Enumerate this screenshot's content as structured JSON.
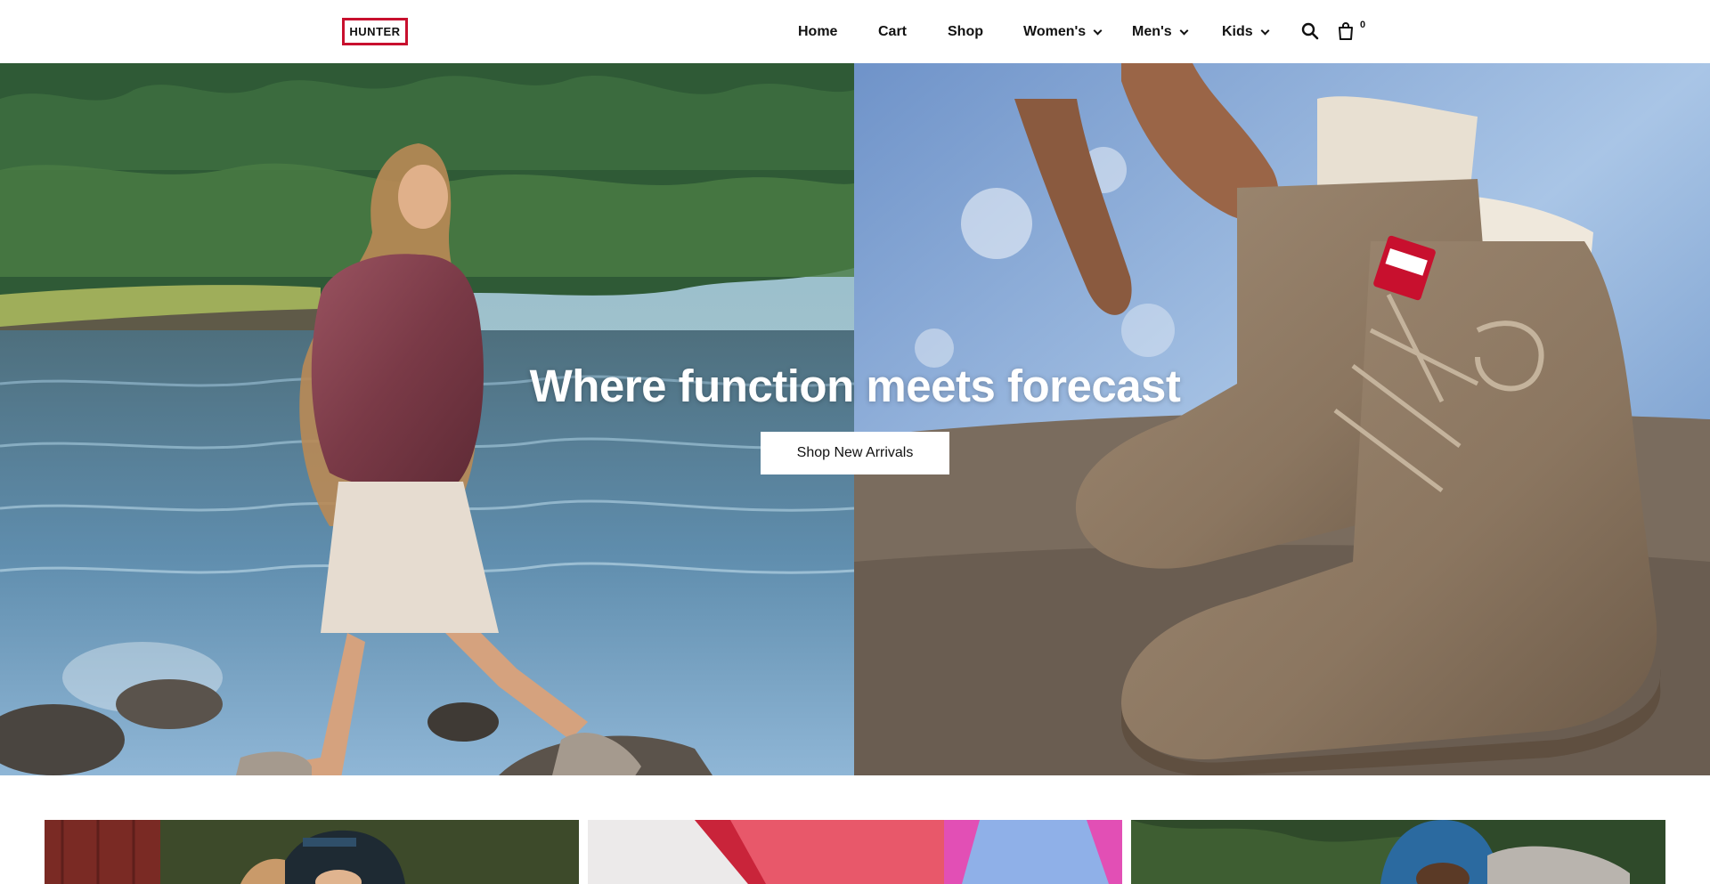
{
  "header": {
    "logo_text": "HUNTER",
    "nav": {
      "home": "Home",
      "cart": "Cart",
      "shop": "Shop",
      "womens": "Women's",
      "mens": "Men's",
      "kids": "Kids"
    },
    "icons": {
      "search": "search-icon",
      "bag": "shopping-bag-icon",
      "dropdown": "chevron-down-icon"
    },
    "cart_count": "0"
  },
  "hero": {
    "title": "Where function meets forecast",
    "cta_label": "Shop New Arrivals"
  },
  "colors": {
    "brand_red": "#c8102e",
    "text": "#111111",
    "background": "#ffffff"
  }
}
